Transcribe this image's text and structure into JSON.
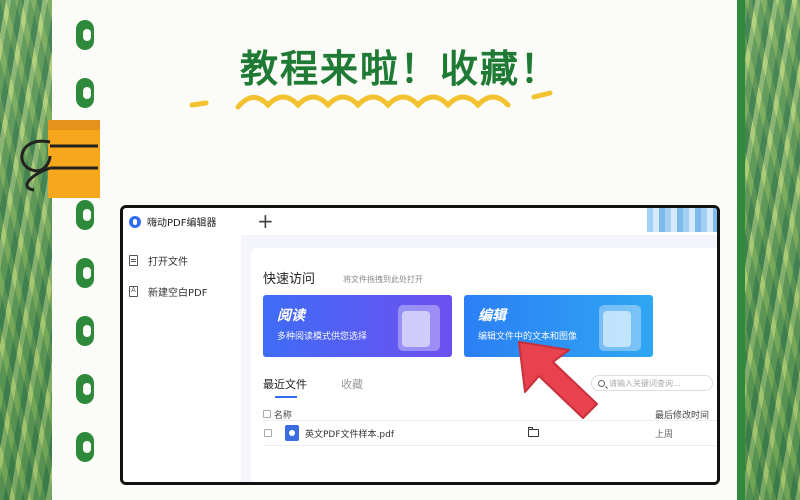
{
  "page": {
    "headline": "教程来啦！收藏！",
    "accent_color": "#1e7a34",
    "clip_color": "#f6a71b",
    "squiggle_color": "#f2c230",
    "arrow_color": "#e8424f"
  },
  "app": {
    "title": "嗨动PDF编辑器",
    "new_tab_label": "+",
    "sidebar": {
      "items": [
        {
          "label": "打开文件",
          "icon": "document-icon"
        },
        {
          "label": "新建空白PDF",
          "icon": "pdf-icon"
        }
      ]
    },
    "quick_access": {
      "title": "快速访问",
      "hint": "将文件拖拽到此处打开",
      "cards": [
        {
          "title": "阅读",
          "subtitle": "多种阅读模式供您选择"
        },
        {
          "title": "编辑",
          "subtitle": "编辑文件中的文本和图像"
        }
      ]
    },
    "tabs": [
      {
        "label": "最近文件",
        "active": true
      },
      {
        "label": "收藏",
        "active": false
      }
    ],
    "search": {
      "placeholder": "请输入关键词查询..."
    },
    "table": {
      "columns": [
        "名称",
        "最后修改时间"
      ],
      "rows": [
        {
          "name": "英文PDF文件样本.pdf",
          "modified": "上周"
        }
      ]
    }
  }
}
